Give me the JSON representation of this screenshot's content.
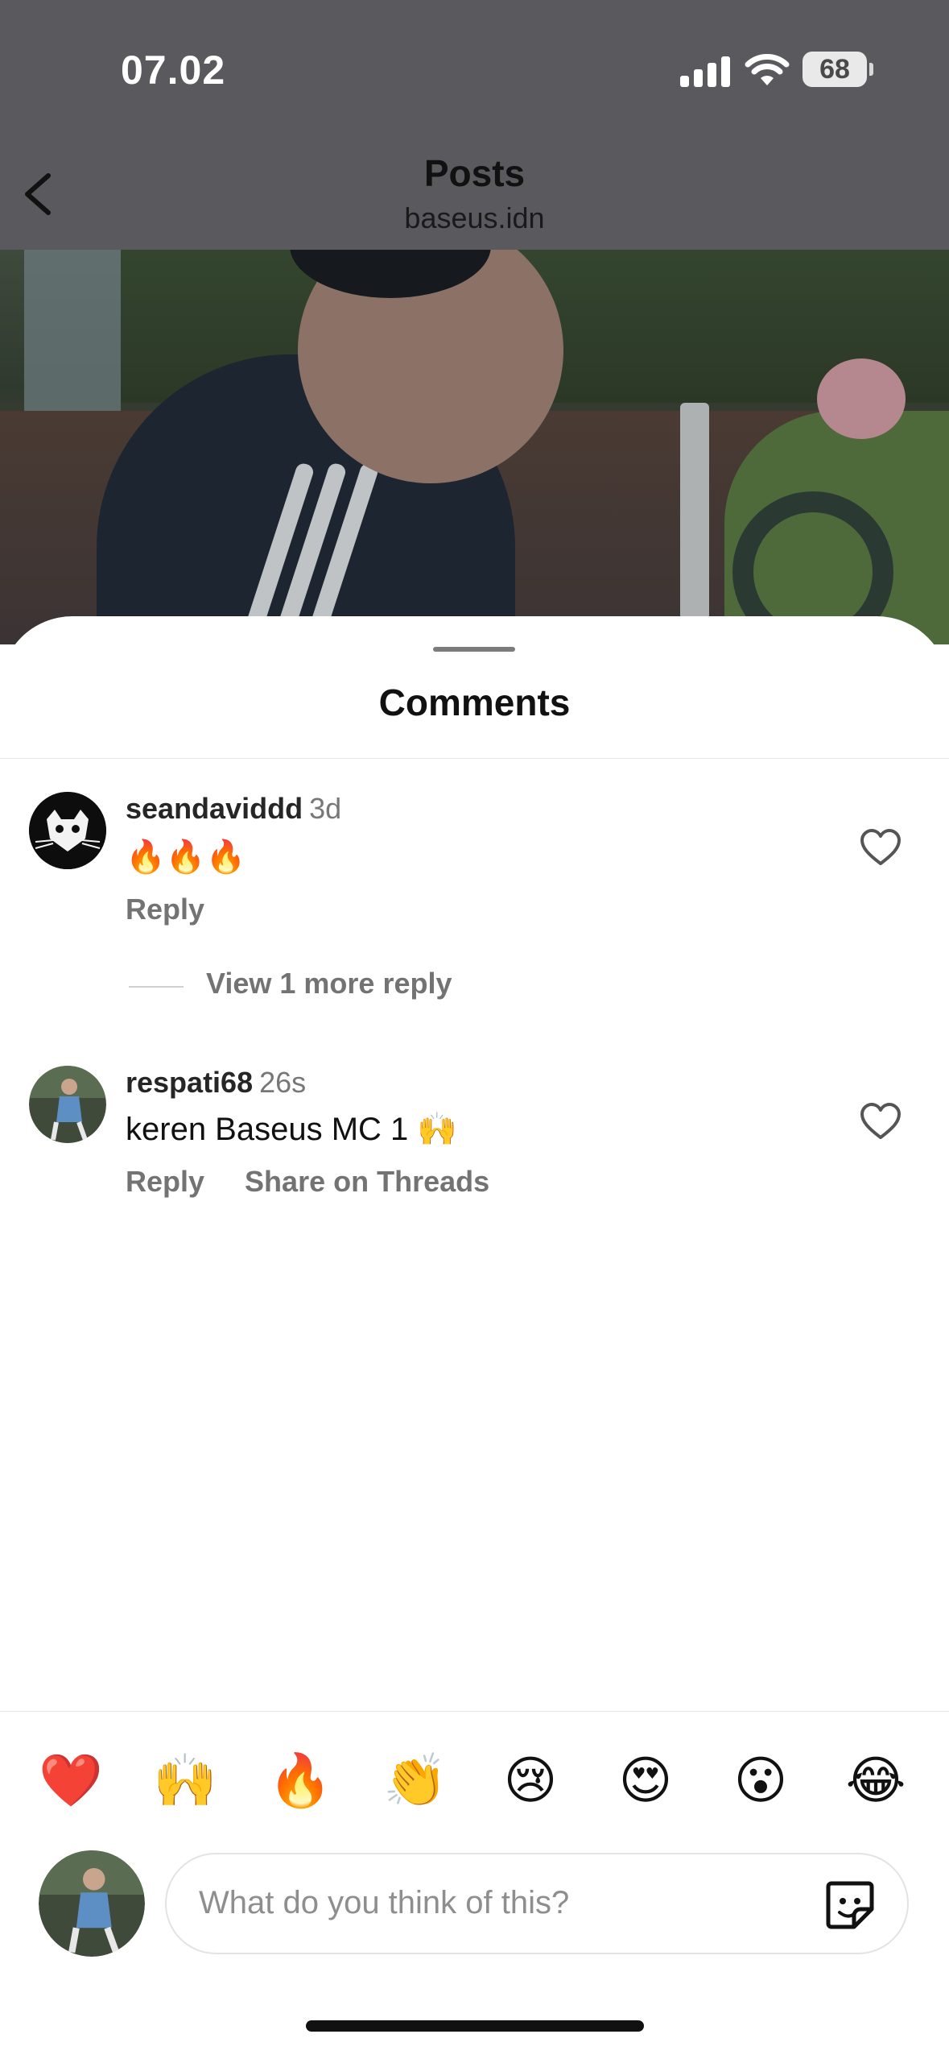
{
  "status_bar": {
    "time": "07.02",
    "battery": "68"
  },
  "header": {
    "title": "Posts",
    "subtitle": "baseus.idn"
  },
  "sheet": {
    "title": "Comments"
  },
  "comments": [
    {
      "username": "seandaviddd",
      "time": "3d",
      "text": "🔥🔥🔥",
      "actions": [
        "Reply"
      ]
    },
    {
      "username": "respati68",
      "time": "26s",
      "text": "keren Baseus MC 1 🙌",
      "actions": [
        "Reply",
        "Share on Threads"
      ]
    }
  ],
  "view_replies_label": "View 1 more reply",
  "quick_reactions": [
    "❤️",
    "🙌",
    "🔥",
    "👏",
    "😢",
    "😍",
    "😮",
    "😂"
  ],
  "composer": {
    "placeholder": "What do you think of this?"
  },
  "icons": {
    "back": "chevron-left-icon",
    "like": "heart-outline-icon",
    "sticker": "sticker-icon",
    "signal": "cellular-signal-icon",
    "wifi": "wifi-icon"
  }
}
